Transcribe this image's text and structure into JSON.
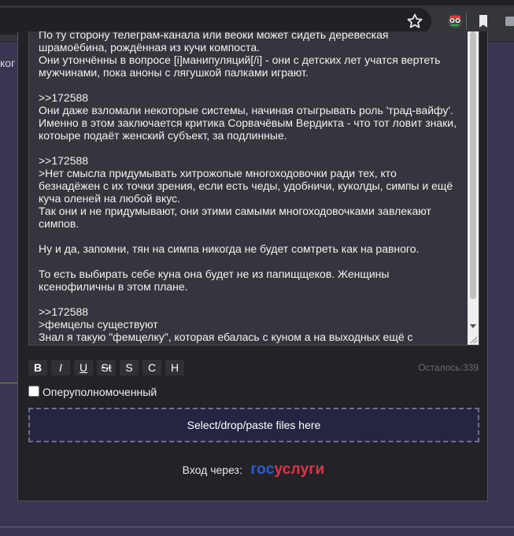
{
  "browser": {
    "icons": [
      "star-icon",
      "extension-icon",
      "bookmark-icon",
      "extensions-puzzle-icon"
    ]
  },
  "background": {
    "side_text": "ког"
  },
  "post_form": {
    "message_lines": [
      "По ту сторону телеграм-канала или веоки может сидеть деревеская",
      "шрамоёбина, рождённая из кучи компоста.",
      "Они утончённы в вопросе [i]манипуляций[/i] - они с детских лет учатся вертеть",
      "мужчинами, пока аноны с лягушкой палками играют.",
      "",
      ">>172588",
      "Они даже взломали некоторые системы, начиная отыгрывать роль 'трад-вайфу'.",
      "Именно в этом заключается критика Сорвачёвым Вердикта - что тот ловит знаки,",
      "котоыре подаёт женский субъект, за подлинные.",
      "",
      ">>172588",
      ">Нет смысла придумывать хитрожопые многоходовочки ради тех, кто",
      "безнадёжен с их точки зрения, если есть чеды, удобничи, куколды, симпы и ещё",
      "куча оленей на любой вкус.",
      "Так они и не придумывают, они этими самыми многоходовочками завлекают",
      "симпов.",
      "",
      "Ну и да, запомни, тян на симпа никогда не будет сомтреть как на равного.",
      "",
      "То есть выбирать себе куна она будет не из папищщеков. Женщины",
      "ксенофиличны в этом плане.",
      "",
      ">>172588",
      ">фемцелы существуют",
      "Знал я такую \"фемцелку\", которая ебалась с куном а на выходных ещё с"
    ],
    "format_buttons": [
      "B",
      "I",
      "U",
      "St",
      "S",
      "C",
      "H"
    ],
    "remaining_label": "Осталось:339",
    "op_checkbox_label": "Оперуполномоченный",
    "op_checkbox_checked": false,
    "dropzone_label": "Select/drop/paste files here",
    "login_label": "Вход через:",
    "login_logo_part1": "гос",
    "login_logo_part2": "услуги"
  },
  "colors": {
    "page_bg": "#3b3551",
    "panel_bg": "#232327",
    "textarea_bg": "#35353d",
    "dropzone_bg": "#252542",
    "gosuslugi_blue": "#2a5bd7",
    "gosuslugi_red": "#e4324a"
  }
}
